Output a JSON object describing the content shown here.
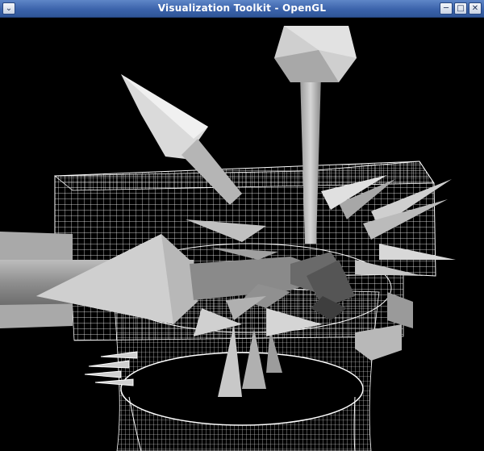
{
  "window": {
    "title": "Visualization Toolkit - OpenGL",
    "buttons": {
      "menu_icon": "chevron-down-icon",
      "minimize_icon": "minimize-icon",
      "maximize_icon": "maximize-icon",
      "close_icon": "close-icon"
    }
  },
  "viewport": {
    "background": "#000000",
    "mesh_color": "#ffffff",
    "glyph_color": "#c8c8c8"
  }
}
